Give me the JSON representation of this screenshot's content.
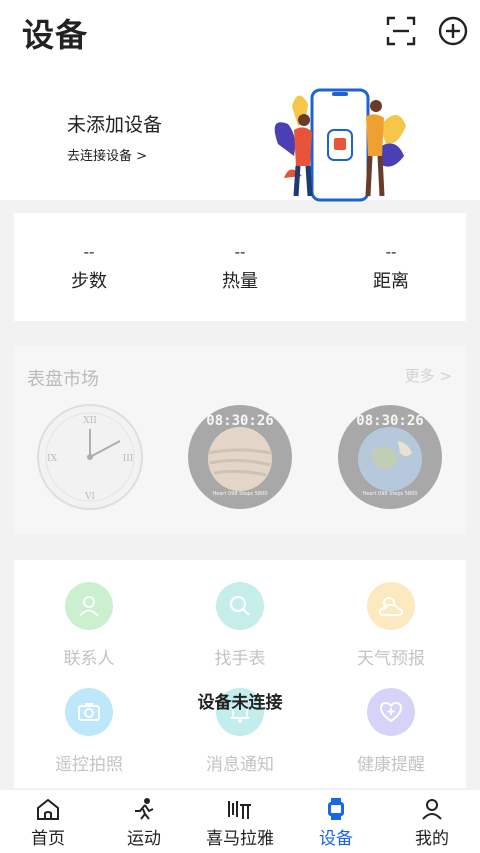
{
  "header": {
    "title": "设备"
  },
  "device": {
    "status": "未添加设备",
    "link": "去连接设备 >"
  },
  "stats": [
    {
      "value": "--",
      "label": "步数"
    },
    {
      "value": "--",
      "label": "热量"
    },
    {
      "value": "--",
      "label": "距离"
    }
  ],
  "market": {
    "title": "表盘市场",
    "more": "更多 >",
    "faces": [
      {
        "time": "",
        "steps": ""
      },
      {
        "time": "08:30:26",
        "steps": "Heart 098  Steps 5800"
      },
      {
        "time": "08:30:26",
        "steps": "Heart 098  Steps 5800"
      }
    ]
  },
  "functions": [
    {
      "label": "联系人",
      "icon": "contact-icon",
      "color": "#6fd27a"
    },
    {
      "label": "找手表",
      "icon": "search-icon",
      "color": "#5bcfc4"
    },
    {
      "label": "天气预报",
      "icon": "weather-icon",
      "color": "#f7c34a"
    },
    {
      "label": "遥控拍照",
      "icon": "camera-icon",
      "color": "#46c0ef"
    },
    {
      "label": "消息通知",
      "icon": "bell-icon",
      "color": "#55c9c9"
    },
    {
      "label": "健康提醒",
      "icon": "heart-plus-icon",
      "color": "#8c84ee"
    }
  ],
  "toast": "设备未连接",
  "tabs": [
    {
      "label": "首页",
      "icon": "home-icon"
    },
    {
      "label": "运动",
      "icon": "runner-icon"
    },
    {
      "label": "喜马拉雅",
      "icon": "ximalaya-icon"
    },
    {
      "label": "设备",
      "icon": "watch-icon"
    },
    {
      "label": "我的",
      "icon": "person-icon"
    }
  ],
  "colors": {
    "accent": "#1a66e6"
  }
}
